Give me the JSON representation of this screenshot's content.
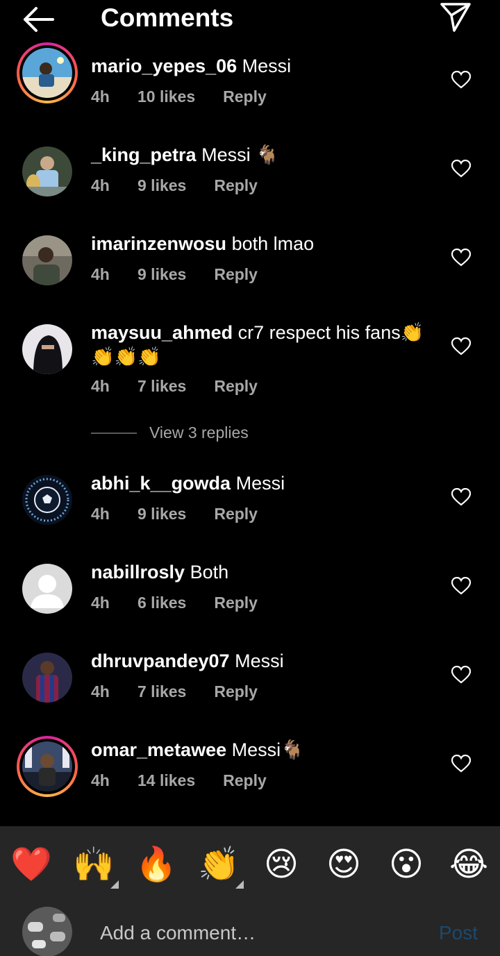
{
  "header": {
    "title": "Comments",
    "back_icon": "arrow-left-icon",
    "send_icon": "paper-plane-icon"
  },
  "comments": [
    {
      "username": "mario_yepes_06",
      "text": "Messi",
      "time": "4h",
      "likes": "10 likes",
      "reply": "Reply",
      "story_ring": true
    },
    {
      "username": "_king_petra",
      "text": "Messi 🐐",
      "time": "4h",
      "likes": "9 likes",
      "reply": "Reply",
      "story_ring": false
    },
    {
      "username": "imarinzenwosu",
      "text": "both lmao",
      "time": "4h",
      "likes": "9 likes",
      "reply": "Reply",
      "story_ring": false
    },
    {
      "username": "maysuu_ahmed",
      "text": "cr7 respect his fans👏👏👏👏",
      "time": "4h",
      "likes": "7 likes",
      "reply": "Reply",
      "story_ring": false
    },
    {
      "username": "abhi_k__gowda",
      "text": "Messi",
      "time": "4h",
      "likes": "9 likes",
      "reply": "Reply",
      "story_ring": false
    },
    {
      "username": "nabillrosly",
      "text": "Both",
      "time": "4h",
      "likes": "6 likes",
      "reply": "Reply",
      "story_ring": false
    },
    {
      "username": "dhruvpandey07",
      "text": "Messi",
      "time": "4h",
      "likes": "7 likes",
      "reply": "Reply",
      "story_ring": false
    },
    {
      "username": "omar_metawee",
      "text": "Messi🐐",
      "time": "4h",
      "likes": "14 likes",
      "reply": "Reply",
      "story_ring": true
    }
  ],
  "view_replies": "View 3 replies",
  "emoji_bar": [
    "❤️",
    "🙌",
    "🔥",
    "👏",
    "😢",
    "😍",
    "😮",
    "😂"
  ],
  "composer": {
    "placeholder": "Add a comment…",
    "post_label": "Post"
  },
  "colors": {
    "background": "#000000",
    "meta": "#a8a8a8",
    "bar": "#262626",
    "post_disabled": "#1b4a6d"
  }
}
